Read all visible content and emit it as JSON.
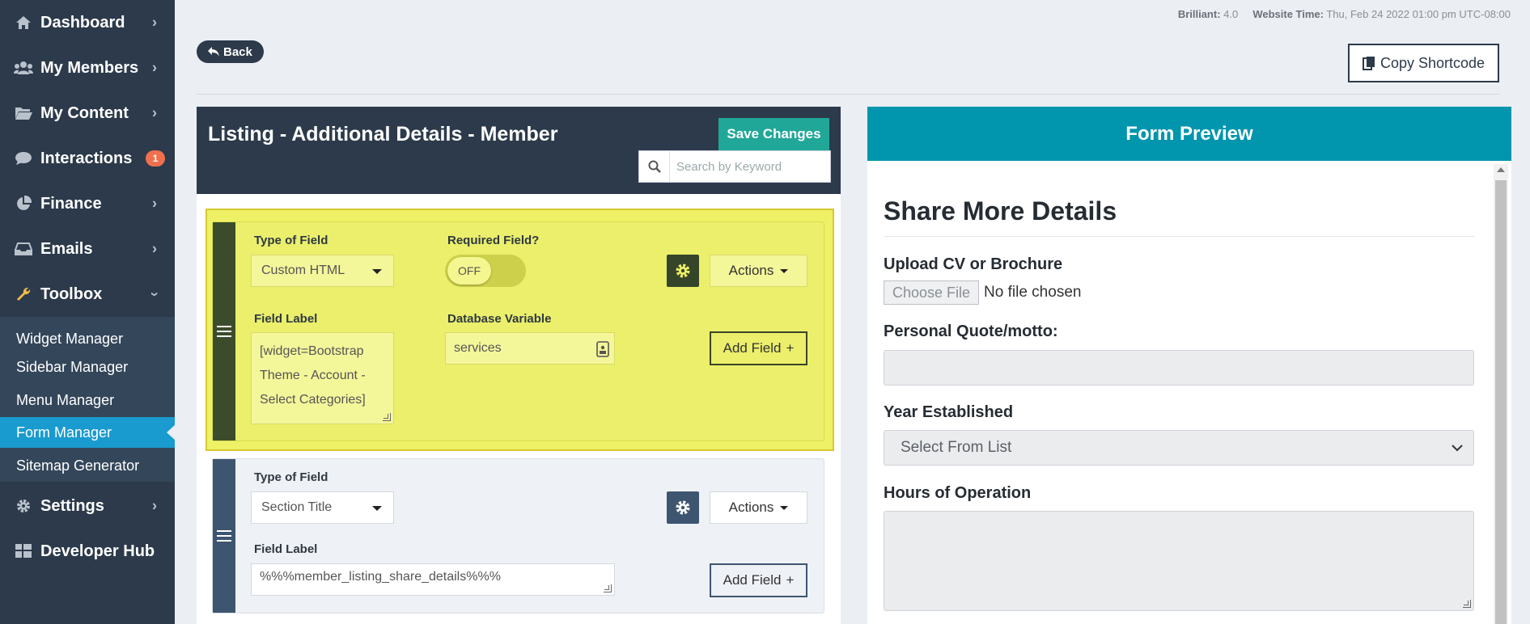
{
  "sidebar": {
    "items": [
      {
        "label": "Dashboard",
        "icon": "home-icon"
      },
      {
        "label": "My Members",
        "icon": "users-icon"
      },
      {
        "label": "My Content",
        "icon": "folder-icon"
      },
      {
        "label": "Interactions",
        "icon": "chat-icon",
        "badge": "1"
      },
      {
        "label": "Finance",
        "icon": "pie-chart-icon"
      },
      {
        "label": "Emails",
        "icon": "inbox-icon"
      },
      {
        "label": "Toolbox",
        "icon": "wrench-icon"
      },
      {
        "label": "Settings",
        "icon": "gear-icon"
      },
      {
        "label": "Developer Hub",
        "icon": "grid-icon"
      }
    ],
    "submenu": [
      {
        "label": "Widget Manager"
      },
      {
        "label": "Sidebar Manager"
      },
      {
        "label": "Menu Manager"
      },
      {
        "label": "Form Manager",
        "active": true
      },
      {
        "label": "Sitemap Generator"
      }
    ]
  },
  "topbar": {
    "version_label": "Brilliant:",
    "version_value": "4.0",
    "time_label": "Website Time:",
    "time_value": "Thu, Feb 24 2022 01:00 pm UTC-08:00",
    "back_label": "Back",
    "copy_label": "Copy Shortcode"
  },
  "editor": {
    "title": "Listing - Additional Details - Member",
    "save_label": "Save Changes",
    "search_placeholder": "Search by Keyword",
    "fields": [
      {
        "type_label": "Type of Field",
        "type_value": "Custom HTML",
        "required_label": "Required Field?",
        "required_value": "OFF",
        "actions_label": "Actions",
        "field_label_label": "Field Label",
        "field_label_value": "[widget=Bootstrap Theme - Account - Select Categories]",
        "db_label": "Database Variable",
        "db_value": "services",
        "add_label": "Add Field"
      },
      {
        "type_label": "Type of Field",
        "type_value": "Section Title",
        "actions_label": "Actions",
        "field_label_label": "Field Label",
        "field_label_value": "%%%member_listing_share_details%%%",
        "add_label": "Add Field"
      }
    ]
  },
  "preview": {
    "header": "Form Preview",
    "title": "Share More Details",
    "upload_label": "Upload CV or Brochure",
    "file_button": "Choose File",
    "file_status": "No file chosen",
    "quote_label": "Personal Quote/motto:",
    "year_label": "Year Established",
    "year_select": "Select From List",
    "hours_label": "Hours of Operation"
  },
  "colors": {
    "sidebar_bg": "#2c3a4b",
    "active_item": "#1a9bcf",
    "save_button": "#21a797",
    "preview_header": "#0196ad",
    "highlight_card": "#ebef6b"
  }
}
